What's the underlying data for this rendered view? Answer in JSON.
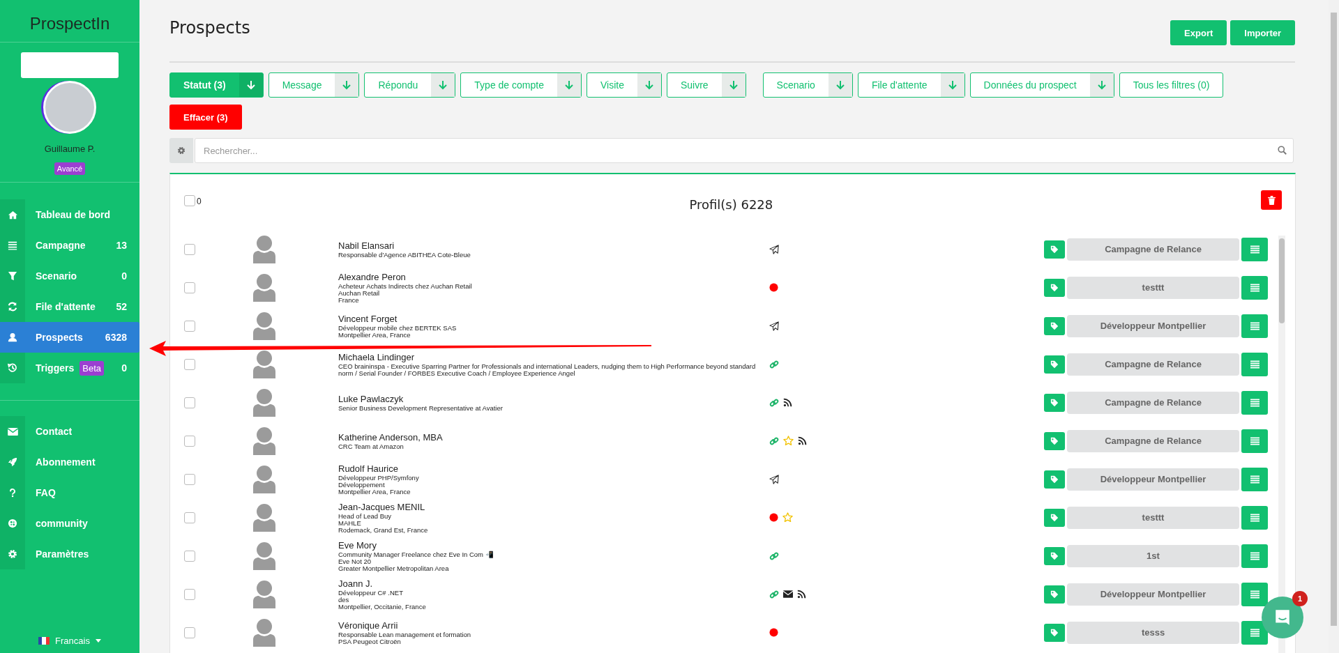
{
  "sidebar": {
    "logo": "ProspectIn",
    "user": {
      "name": "Guillaume P.",
      "badge": "Avancé"
    },
    "nav": [
      {
        "label": "Tableau de bord",
        "selected": false
      },
      {
        "label": "Campagne",
        "count": "13",
        "selected": false
      },
      {
        "label": "Scenario",
        "count": "0",
        "selected": false
      },
      {
        "label": "File d'attente",
        "count": "52",
        "selected": false
      },
      {
        "label": "Prospects",
        "count": "6328",
        "selected": true
      },
      {
        "label": "Triggers",
        "badge": "Beta",
        "count": "0",
        "selected": false
      }
    ],
    "secondary_nav": [
      {
        "label": "Contact"
      },
      {
        "label": "Abonnement"
      },
      {
        "label": "FAQ"
      },
      {
        "label": "community"
      },
      {
        "label": "Paramètres"
      }
    ],
    "language": {
      "label": "Francais"
    }
  },
  "header": {
    "title": "Prospects",
    "buttons": [
      "Export",
      "Importer"
    ]
  },
  "filters": [
    {
      "label": "Statut (3)",
      "kind": "dropdown",
      "selected": true
    },
    {
      "label": "Message",
      "kind": "dropdown",
      "selected": false
    },
    {
      "label": "Répondu",
      "kind": "dropdown",
      "selected": false
    },
    {
      "label": "Type de compte",
      "kind": "dropdown",
      "selected": false
    },
    {
      "label": "Visite",
      "kind": "dropdown",
      "selected": false
    },
    {
      "label": "Suivre",
      "kind": "dropdown",
      "selected": false
    },
    {
      "label": "Scenario",
      "kind": "dropdown",
      "selected": false
    },
    {
      "label": "File d'attente",
      "kind": "dropdown",
      "selected": false
    },
    {
      "label": "Données du prospect",
      "kind": "dropdown",
      "selected": false
    },
    {
      "label": "Tous les filtres (0)",
      "kind": "plain",
      "selected": false
    }
  ],
  "clear_button": "Effacer (3)",
  "search": {
    "placeholder": "Rechercher..."
  },
  "list": {
    "select_all": {
      "checked": false,
      "count": "0"
    },
    "title": "Profil(s) 6228",
    "rows": [
      {
        "checked": false,
        "name": "Nabil Elansari",
        "details": [
          "Responsable d'Agence ABITHEA Cote-Bleue"
        ],
        "indicators": [
          {
            "kind": "sent"
          }
        ],
        "campaign": "Campagne de Relance"
      },
      {
        "checked": false,
        "name": "Alexandre Peron",
        "details": [
          "Acheteur Achats Indirects chez Auchan Retail",
          "Auchan Retail",
          "France"
        ],
        "indicators": [
          {
            "kind": "dot"
          }
        ],
        "campaign": "testtt"
      },
      {
        "checked": false,
        "name": "Vincent Forget",
        "details": [
          "Développeur mobile chez BERTEK SAS",
          "Montpellier Area, France"
        ],
        "indicators": [
          {
            "kind": "sent"
          }
        ],
        "campaign": "Développeur Montpellier"
      },
      {
        "checked": false,
        "name": "Michaela Lindinger",
        "details": [
          "CEO braininspa - Executive Sparring Partner for Professionals and international Leaders, nudging them to High Performance beyond standard norm / Serial Founder / FORBES Executive Coach / Employee Experience Angel"
        ],
        "indicators": [
          {
            "kind": "link"
          }
        ],
        "campaign": "Campagne de Relance"
      },
      {
        "checked": false,
        "name": "Luke Pawlaczyk",
        "details": [
          "Senior Business Development Representative at Avatier"
        ],
        "indicators": [
          {
            "kind": "link"
          },
          {
            "kind": "rss"
          }
        ],
        "campaign": "Campagne de Relance"
      },
      {
        "checked": false,
        "name": "Katherine Anderson, MBA",
        "details": [
          "CRC Team at Amazon"
        ],
        "indicators": [
          {
            "kind": "link"
          },
          {
            "kind": "star"
          },
          {
            "kind": "rss"
          }
        ],
        "campaign": "Campagne de Relance"
      },
      {
        "checked": false,
        "name": "Rudolf Haurice",
        "details": [
          "Développeur PHP/Symfony",
          "Développement",
          "Montpellier Area, France"
        ],
        "indicators": [
          {
            "kind": "sent"
          }
        ],
        "campaign": "Développeur Montpellier"
      },
      {
        "checked": false,
        "name": "Jean-Jacques MENIL",
        "details": [
          "Head of Lead Buy",
          "MAHLE",
          "Rodemack, Grand Est, France"
        ],
        "indicators": [
          {
            "kind": "dot"
          },
          {
            "kind": "star"
          }
        ],
        "campaign": "testtt"
      },
      {
        "checked": false,
        "name": "Eve Mory",
        "details": [
          "Community Manager Freelance chez Eve In Com 📲",
          "Eve Not 20",
          "Greater Montpellier Metropolitan Area"
        ],
        "indicators": [
          {
            "kind": "link"
          }
        ],
        "campaign": "1st"
      },
      {
        "checked": false,
        "name": "Joann J.",
        "details": [
          "Développeur C# .NET",
          "des",
          "Montpellier, Occitanie, France"
        ],
        "indicators": [
          {
            "kind": "link"
          },
          {
            "kind": "mail"
          },
          {
            "kind": "rss"
          }
        ],
        "campaign": "Développeur Montpellier"
      },
      {
        "checked": false,
        "name": "Véronique Arrii",
        "details": [
          "Responsable Lean management et formation",
          "PSA Peugeot Citroën"
        ],
        "indicators": [
          {
            "kind": "dot"
          }
        ],
        "campaign": "tesss"
      }
    ]
  },
  "chat": {
    "badge": "1"
  }
}
